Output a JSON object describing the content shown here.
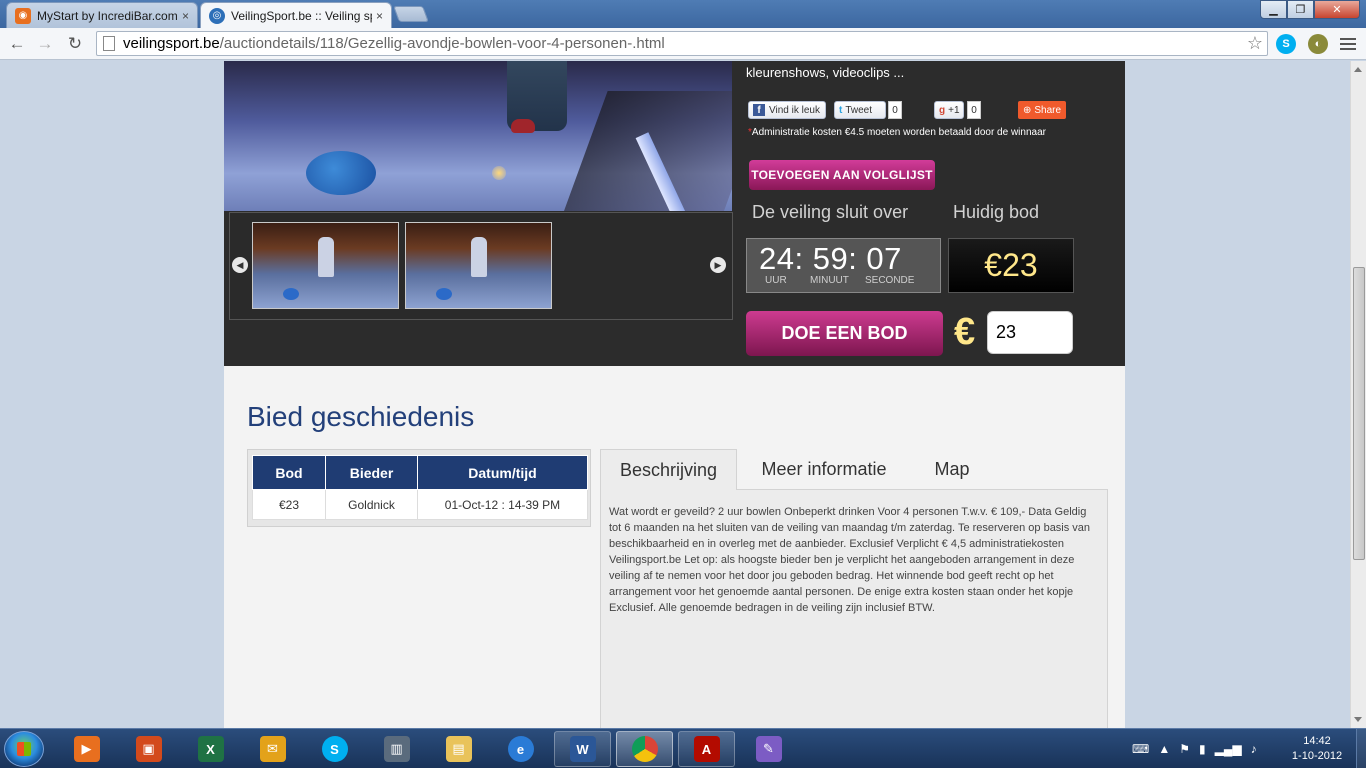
{
  "browser": {
    "tabs": [
      {
        "title": "MyStart by IncrediBar.com",
        "close": "×"
      },
      {
        "title": "VeilingSport.be :: Veiling sp",
        "close": "×"
      }
    ],
    "window_buttons": {
      "minimize": "▁",
      "maximize": "❐",
      "close": "✕"
    },
    "nav": {
      "back": "←",
      "forward": "→",
      "reload": "↻"
    },
    "url_host": "veilingsport.be",
    "url_path": "/auctiondetails/118/Gezellig-avondje-bowlen-voor-4-personen-.html",
    "bookmark_star": "☆"
  },
  "auction": {
    "description_snippet": "kleurenshows, videoclips ...",
    "social": {
      "facebook_label": "Vind ik leuk",
      "tweet_label": "Tweet",
      "tweet_count": "0",
      "gplus_label": "+1",
      "gplus_count": "0",
      "share_label": "Share"
    },
    "admin_note_asterisk": "*",
    "admin_note": "Administratie kosten €4.5 moeten worden betaald door de winnaar",
    "watchlist_button": "TOEVOEGEN AAN VOLGLIJST",
    "closes_label": "De veiling sluit over",
    "current_bid_label": "Huidig bod",
    "countdown": {
      "display": "24: 59: 07",
      "unit_hours": "UUR",
      "unit_minutes": "MINUUT",
      "unit_seconds": "SECONDE"
    },
    "current_bid": "€23",
    "bid_button": "DOE EEN BOD",
    "currency_symbol": "€",
    "bid_input_value": "23",
    "thumb_nav": {
      "prev": "◀",
      "next": "▶"
    }
  },
  "history": {
    "title": "Bied geschiedenis",
    "columns": [
      "Bod",
      "Bieder",
      "Datum/tijd"
    ],
    "rows": [
      [
        "€23",
        "Goldnick",
        "01-Oct-12 : 14-39 PM"
      ]
    ]
  },
  "info_tabs": {
    "tabs": [
      "Beschrijving",
      "Meer informatie",
      "Map"
    ],
    "active": "Beschrijving",
    "description": "Wat wordt er geveild? 2 uur bowlen Onbeperkt drinken Voor 4 personen T.w.v. € 109,- Data Geldig tot 6 maanden na het sluiten van de veiling van maandag t/m zaterdag. Te reserveren op basis van beschikbaarheid en in overleg met de aanbieder. Exclusief Verplicht € 4,5 administratiekosten Veilingsport.be Let op: als hoogste bieder ben je verplicht het aangeboden arrangement in deze veiling af te nemen voor het door jou geboden bedrag. Het winnende bod geeft recht op het arrangement voor het genoemde aantal personen. De enige extra kosten staan onder het kopje Exclusief. Alle genoemde bedragen in de veiling zijn inclusief BTW."
  },
  "taskbar": {
    "clock_time": "14:42",
    "clock_date": "1-10-2012"
  },
  "colors": {
    "accent_magenta": "#b52a7c",
    "heading_blue": "#23407a",
    "table_header": "#1f3c73",
    "bid_yellow": "#ffe78a"
  }
}
